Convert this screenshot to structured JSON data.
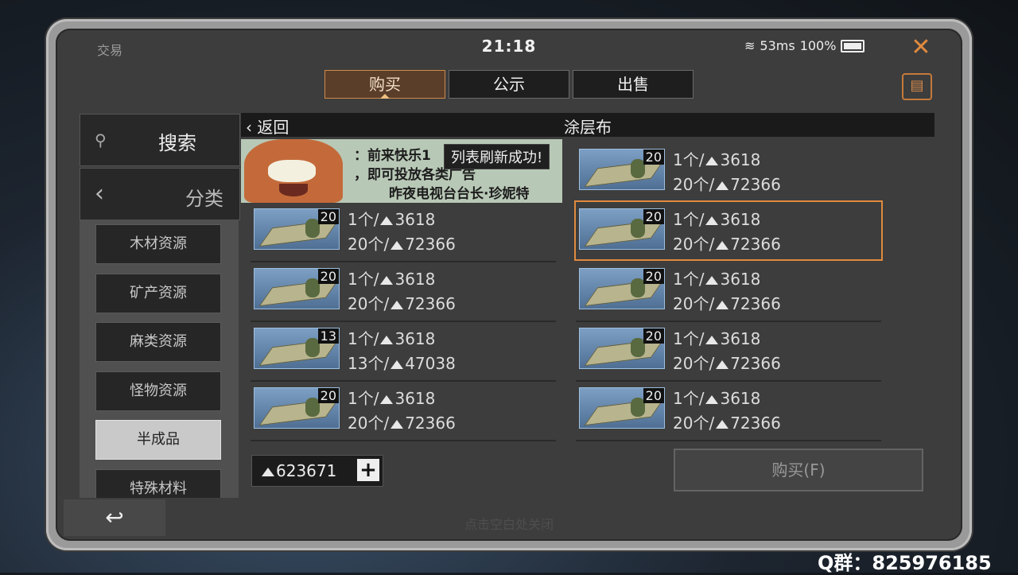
{
  "status": {
    "app_label": "交易",
    "time": "21:18",
    "ping": "53ms",
    "battery": "100%"
  },
  "tabs": [
    {
      "label": "购买",
      "active": true
    },
    {
      "label": "公示",
      "active": false
    },
    {
      "label": "出售",
      "active": false
    }
  ],
  "sidebar": {
    "search_label": "搜索",
    "category_label": "分类",
    "items": [
      {
        "label": "木材资源"
      },
      {
        "label": "矿产资源"
      },
      {
        "label": "麻类资源"
      },
      {
        "label": "怪物资源"
      },
      {
        "label": "半成品",
        "active": true
      },
      {
        "label": "特殊材料"
      }
    ]
  },
  "header": {
    "back_label": "返回",
    "title": "涂层布"
  },
  "banner": {
    "line1": "：前来快乐1",
    "line2": "，即可投放各类广告",
    "line3": "昨夜电视台台长·珍妮特"
  },
  "toast": "列表刷新成功!",
  "listings": [
    {
      "qty": "20",
      "unit": "1个/",
      "unit_price": "3618",
      "total_qty": "20个/",
      "total_price": "72366",
      "selected": false
    },
    {
      "qty": "20",
      "unit": "1个/",
      "unit_price": "3618",
      "total_qty": "20个/",
      "total_price": "72366",
      "selected": false
    },
    {
      "qty": "20",
      "unit": "1个/",
      "unit_price": "3618",
      "total_qty": "20个/",
      "total_price": "72366",
      "selected": true
    },
    {
      "qty": "20",
      "unit": "1个/",
      "unit_price": "3618",
      "total_qty": "20个/",
      "total_price": "72366",
      "selected": false
    },
    {
      "qty": "20",
      "unit": "1个/",
      "unit_price": "3618",
      "total_qty": "20个/",
      "total_price": "72366",
      "selected": false
    },
    {
      "qty": "13",
      "unit": "1个/",
      "unit_price": "3618",
      "total_qty": "13个/",
      "total_price": "47038",
      "selected": false
    },
    {
      "qty": "20",
      "unit": "1个/",
      "unit_price": "3618",
      "total_qty": "20个/",
      "total_price": "72366",
      "selected": false
    },
    {
      "qty": "20",
      "unit": "1个/",
      "unit_price": "3618",
      "total_qty": "20个/",
      "total_price": "72366",
      "selected": false
    },
    {
      "qty": "20",
      "unit": "1个/",
      "unit_price": "3618",
      "total_qty": "20个/",
      "total_price": "72366",
      "selected": false
    }
  ],
  "wallet": {
    "balance": "623671"
  },
  "buy_button": "购买(F)",
  "close_hint": "点击空白处关闭",
  "watermark": "Q群：825976185",
  "icons": {
    "search": "search-icon",
    "back": "chevron-left-icon",
    "close": "close-icon",
    "clipboard": "clipboard-icon",
    "wifi": "wifi-icon",
    "battery": "battery-icon",
    "coin": "currency-icon",
    "plus": "plus-icon",
    "undo": "return-icon"
  },
  "colors": {
    "accent": "#e08a3e",
    "panel": "#3d3d3d"
  }
}
